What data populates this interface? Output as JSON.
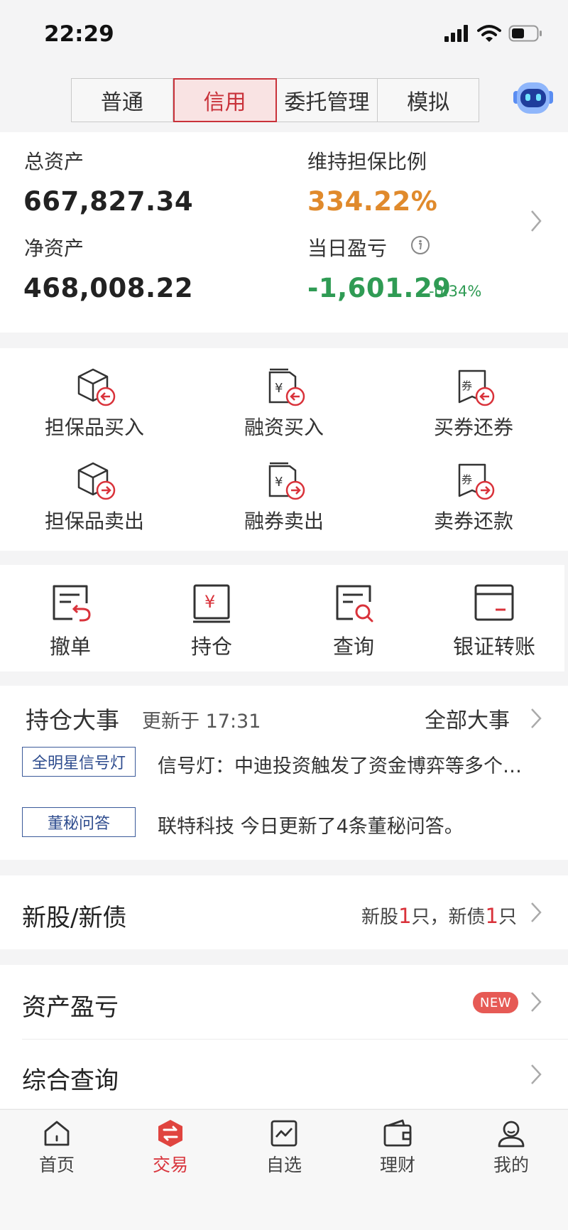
{
  "status_bar": {
    "time": "22:29"
  },
  "segment_tabs": [
    {
      "label": "普通",
      "active": false
    },
    {
      "label": "信用",
      "active": true
    },
    {
      "label": "委托管理",
      "active": false
    },
    {
      "label": "模拟",
      "active": false
    }
  ],
  "assets": {
    "total_label": "总资产",
    "total_value": "667,827.34",
    "ratio_label": "维持担保比例",
    "ratio_value": "334.22%",
    "net_label": "净资产",
    "net_value": "468,008.22",
    "pnl_label": "当日盈亏",
    "pnl_value": "-1,601.29",
    "pnl_pct": "-0.34%"
  },
  "credit_actions": [
    {
      "label": "担保品买入",
      "icon": "collateral-buy-icon"
    },
    {
      "label": "融资买入",
      "icon": "margin-buy-icon"
    },
    {
      "label": "买券还券",
      "icon": "buy-repay-icon"
    },
    {
      "label": "担保品卖出",
      "icon": "collateral-sell-icon"
    },
    {
      "label": "融券卖出",
      "icon": "short-sell-icon"
    },
    {
      "label": "卖券还款",
      "icon": "sell-repay-icon"
    }
  ],
  "tools": [
    {
      "label": "撤单",
      "icon": "cancel-order-icon"
    },
    {
      "label": "持仓",
      "icon": "position-icon"
    },
    {
      "label": "查询",
      "icon": "query-icon"
    },
    {
      "label": "银证转账",
      "icon": "transfer-icon"
    }
  ],
  "news": {
    "title": "持仓大事",
    "updated": "更新于 17:31",
    "all_link": "全部大事",
    "items": [
      {
        "tag": "全明星信号灯",
        "text": "信号灯：中迪投资触发了资金博弈等多个…"
      },
      {
        "tag": "董秘问答",
        "text": "联特科技 今日更新了4条董秘问答。"
      }
    ]
  },
  "ipo": {
    "label": "新股/新债",
    "stock_prefix": "新股",
    "stock_count": "1",
    "stock_suffix": "只，新债",
    "bond_count": "1",
    "bond_suffix": "只"
  },
  "menu": {
    "asset_pnl": "资产盈亏",
    "new_badge": "NEW",
    "query": "综合查询"
  },
  "bottom_nav": [
    {
      "label": "首页",
      "active": false
    },
    {
      "label": "交易",
      "active": true
    },
    {
      "label": "自选",
      "active": false
    },
    {
      "label": "理财",
      "active": false
    },
    {
      "label": "我的",
      "active": false
    }
  ],
  "colors": {
    "brand_red": "#d9323a",
    "ratio_orange": "#e08a2c",
    "loss_green": "#2f9b54",
    "tag_blue": "#2e4c8e"
  }
}
